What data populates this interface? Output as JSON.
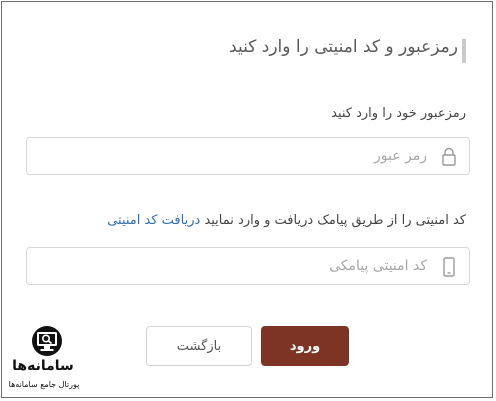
{
  "form": {
    "title": "رمزعبور و کد امنیتی را وارد کنید",
    "password": {
      "label": "رمزعبور خود را وارد کنید",
      "placeholder": "رمز عبور",
      "value": "",
      "icon": "lock-icon"
    },
    "security_code": {
      "label_text": "کد امنیتی را از طریق پیامک دریافت و وارد نمایید",
      "link_text": "دریافت کد امنیتی",
      "placeholder": "کد امنیتی پیامکی",
      "value": "",
      "icon": "mobile-phone-icon"
    },
    "buttons": {
      "back_label": "بازگشت",
      "login_label": "ورود"
    }
  },
  "watermark": {
    "name": "سامانه‌ها",
    "subtitle": "پورتال جامع سامانه‌ها",
    "icon": "monitor-search-logo"
  },
  "colors": {
    "primary": "#7d3424",
    "link": "#2f6fb0",
    "border": "#d8d8d8",
    "text": "#444444"
  }
}
